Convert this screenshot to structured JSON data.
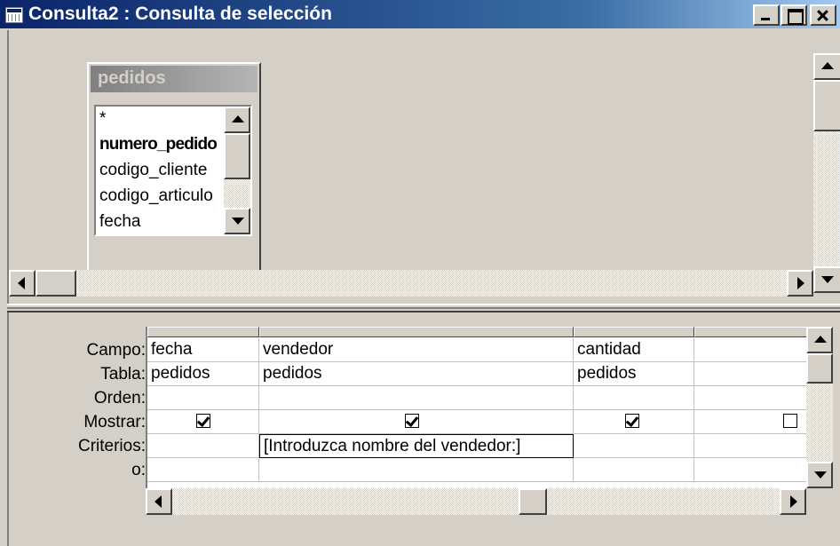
{
  "window": {
    "title": "Consulta2 : Consulta de selección"
  },
  "field_list": {
    "title": "pedidos",
    "items": [
      "*",
      "numero_pedido",
      "codigo_cliente",
      "codigo_articulo",
      "fecha"
    ]
  },
  "grid": {
    "row_labels": [
      "Campo:",
      "Tabla:",
      "Orden:",
      "Mostrar:",
      "Criterios:",
      "o:"
    ],
    "columns": [
      {
        "campo": "fecha",
        "tabla": "pedidos",
        "orden": "",
        "mostrar": true,
        "criterios": ""
      },
      {
        "campo": "vendedor",
        "tabla": "pedidos",
        "orden": "",
        "mostrar": true,
        "criterios": "[Introduzca nombre del vendedor:]"
      },
      {
        "campo": "cantidad",
        "tabla": "pedidos",
        "orden": "",
        "mostrar": true,
        "criterios": ""
      },
      {
        "campo": "",
        "tabla": "",
        "orden": "",
        "mostrar": false,
        "criterios": ""
      }
    ]
  },
  "icons": [
    "query-window-icon",
    "minimize-icon",
    "maximize-icon",
    "close-icon",
    "scroll-up-icon",
    "scroll-down-icon",
    "scroll-left-icon",
    "scroll-right-icon"
  ]
}
